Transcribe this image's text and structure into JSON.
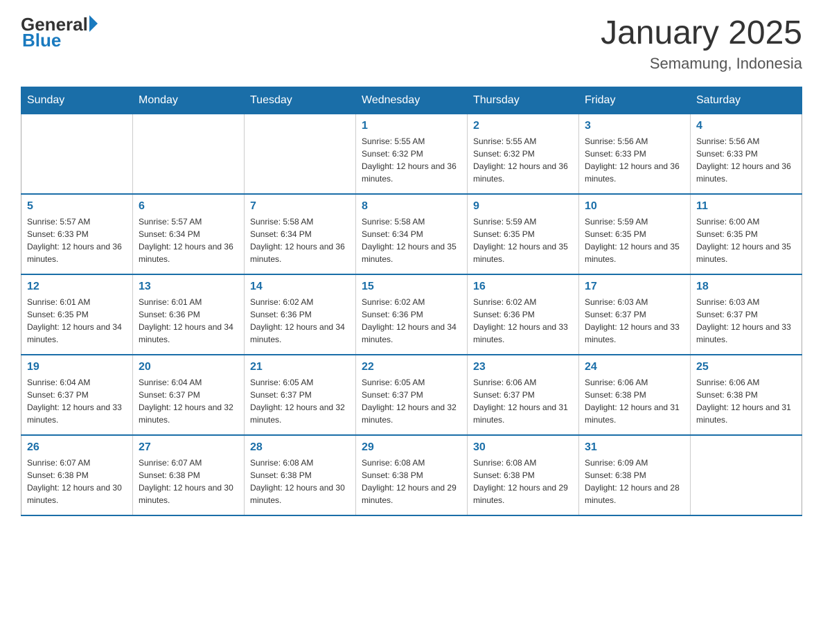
{
  "logo": {
    "general": "General",
    "blue": "Blue"
  },
  "title": "January 2025",
  "subtitle": "Semamung, Indonesia",
  "days_of_week": [
    "Sunday",
    "Monday",
    "Tuesday",
    "Wednesday",
    "Thursday",
    "Friday",
    "Saturday"
  ],
  "weeks": [
    {
      "days": [
        {
          "number": "",
          "info": ""
        },
        {
          "number": "",
          "info": ""
        },
        {
          "number": "",
          "info": ""
        },
        {
          "number": "1",
          "info": "Sunrise: 5:55 AM\nSunset: 6:32 PM\nDaylight: 12 hours and 36 minutes."
        },
        {
          "number": "2",
          "info": "Sunrise: 5:55 AM\nSunset: 6:32 PM\nDaylight: 12 hours and 36 minutes."
        },
        {
          "number": "3",
          "info": "Sunrise: 5:56 AM\nSunset: 6:33 PM\nDaylight: 12 hours and 36 minutes."
        },
        {
          "number": "4",
          "info": "Sunrise: 5:56 AM\nSunset: 6:33 PM\nDaylight: 12 hours and 36 minutes."
        }
      ]
    },
    {
      "days": [
        {
          "number": "5",
          "info": "Sunrise: 5:57 AM\nSunset: 6:33 PM\nDaylight: 12 hours and 36 minutes."
        },
        {
          "number": "6",
          "info": "Sunrise: 5:57 AM\nSunset: 6:34 PM\nDaylight: 12 hours and 36 minutes."
        },
        {
          "number": "7",
          "info": "Sunrise: 5:58 AM\nSunset: 6:34 PM\nDaylight: 12 hours and 36 minutes."
        },
        {
          "number": "8",
          "info": "Sunrise: 5:58 AM\nSunset: 6:34 PM\nDaylight: 12 hours and 35 minutes."
        },
        {
          "number": "9",
          "info": "Sunrise: 5:59 AM\nSunset: 6:35 PM\nDaylight: 12 hours and 35 minutes."
        },
        {
          "number": "10",
          "info": "Sunrise: 5:59 AM\nSunset: 6:35 PM\nDaylight: 12 hours and 35 minutes."
        },
        {
          "number": "11",
          "info": "Sunrise: 6:00 AM\nSunset: 6:35 PM\nDaylight: 12 hours and 35 minutes."
        }
      ]
    },
    {
      "days": [
        {
          "number": "12",
          "info": "Sunrise: 6:01 AM\nSunset: 6:35 PM\nDaylight: 12 hours and 34 minutes."
        },
        {
          "number": "13",
          "info": "Sunrise: 6:01 AM\nSunset: 6:36 PM\nDaylight: 12 hours and 34 minutes."
        },
        {
          "number": "14",
          "info": "Sunrise: 6:02 AM\nSunset: 6:36 PM\nDaylight: 12 hours and 34 minutes."
        },
        {
          "number": "15",
          "info": "Sunrise: 6:02 AM\nSunset: 6:36 PM\nDaylight: 12 hours and 34 minutes."
        },
        {
          "number": "16",
          "info": "Sunrise: 6:02 AM\nSunset: 6:36 PM\nDaylight: 12 hours and 33 minutes."
        },
        {
          "number": "17",
          "info": "Sunrise: 6:03 AM\nSunset: 6:37 PM\nDaylight: 12 hours and 33 minutes."
        },
        {
          "number": "18",
          "info": "Sunrise: 6:03 AM\nSunset: 6:37 PM\nDaylight: 12 hours and 33 minutes."
        }
      ]
    },
    {
      "days": [
        {
          "number": "19",
          "info": "Sunrise: 6:04 AM\nSunset: 6:37 PM\nDaylight: 12 hours and 33 minutes."
        },
        {
          "number": "20",
          "info": "Sunrise: 6:04 AM\nSunset: 6:37 PM\nDaylight: 12 hours and 32 minutes."
        },
        {
          "number": "21",
          "info": "Sunrise: 6:05 AM\nSunset: 6:37 PM\nDaylight: 12 hours and 32 minutes."
        },
        {
          "number": "22",
          "info": "Sunrise: 6:05 AM\nSunset: 6:37 PM\nDaylight: 12 hours and 32 minutes."
        },
        {
          "number": "23",
          "info": "Sunrise: 6:06 AM\nSunset: 6:37 PM\nDaylight: 12 hours and 31 minutes."
        },
        {
          "number": "24",
          "info": "Sunrise: 6:06 AM\nSunset: 6:38 PM\nDaylight: 12 hours and 31 minutes."
        },
        {
          "number": "25",
          "info": "Sunrise: 6:06 AM\nSunset: 6:38 PM\nDaylight: 12 hours and 31 minutes."
        }
      ]
    },
    {
      "days": [
        {
          "number": "26",
          "info": "Sunrise: 6:07 AM\nSunset: 6:38 PM\nDaylight: 12 hours and 30 minutes."
        },
        {
          "number": "27",
          "info": "Sunrise: 6:07 AM\nSunset: 6:38 PM\nDaylight: 12 hours and 30 minutes."
        },
        {
          "number": "28",
          "info": "Sunrise: 6:08 AM\nSunset: 6:38 PM\nDaylight: 12 hours and 30 minutes."
        },
        {
          "number": "29",
          "info": "Sunrise: 6:08 AM\nSunset: 6:38 PM\nDaylight: 12 hours and 29 minutes."
        },
        {
          "number": "30",
          "info": "Sunrise: 6:08 AM\nSunset: 6:38 PM\nDaylight: 12 hours and 29 minutes."
        },
        {
          "number": "31",
          "info": "Sunrise: 6:09 AM\nSunset: 6:38 PM\nDaylight: 12 hours and 28 minutes."
        },
        {
          "number": "",
          "info": ""
        }
      ]
    }
  ]
}
